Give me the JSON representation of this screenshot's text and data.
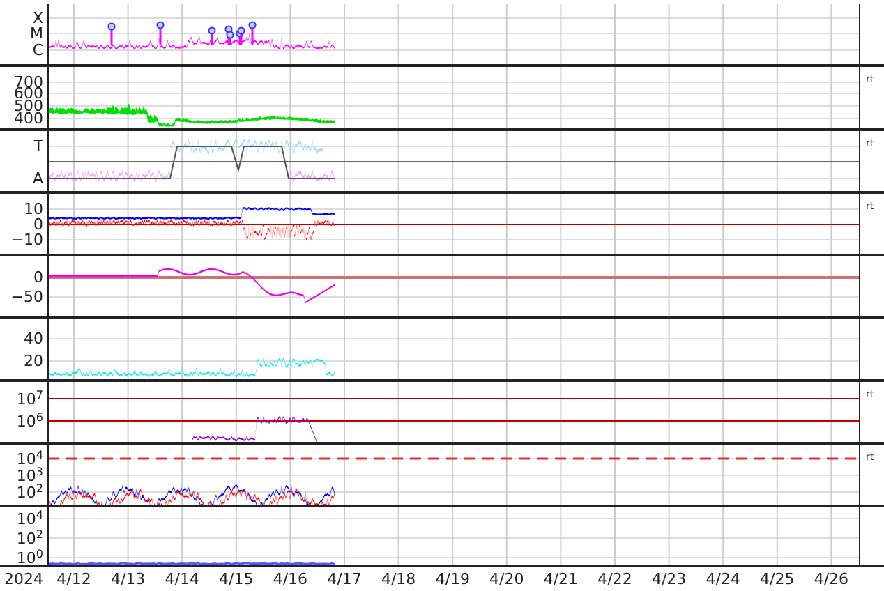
{
  "panels": [
    {
      "y_labels": [
        "X",
        "M",
        "C"
      ]
    },
    {
      "y_labels": [
        "700",
        "600",
        "500",
        "400"
      ],
      "right_label": "rt"
    },
    {
      "y_labels": [
        "T",
        "A"
      ],
      "right_label": "rt"
    },
    {
      "y_labels": [
        "10",
        "0",
        "−10"
      ],
      "right_label": "rt"
    },
    {
      "y_labels": [
        "0",
        "−50"
      ]
    },
    {
      "y_labels": [
        "40",
        "20"
      ]
    },
    {
      "y_labels": [
        "10$^{7}$",
        "10$^{6}$"
      ],
      "right_label": "rt"
    },
    {
      "y_labels": [
        "10$^{4}$",
        "10$^{3}$",
        "10$^{2}$"
      ],
      "right_label": "rt"
    },
    {
      "y_labels": [
        "10$^{4}$",
        "10$^{2}$",
        "10$^{0}$"
      ]
    }
  ],
  "x_axis": {
    "year": "2024",
    "labels": [
      "4/12",
      "4/13",
      "4/14",
      "4/15",
      "4/16",
      "4/17",
      "4/18",
      "4/19",
      "4/20",
      "4/21",
      "4/22",
      "4/23",
      "4/24",
      "4/25",
      "4/26"
    ]
  }
}
